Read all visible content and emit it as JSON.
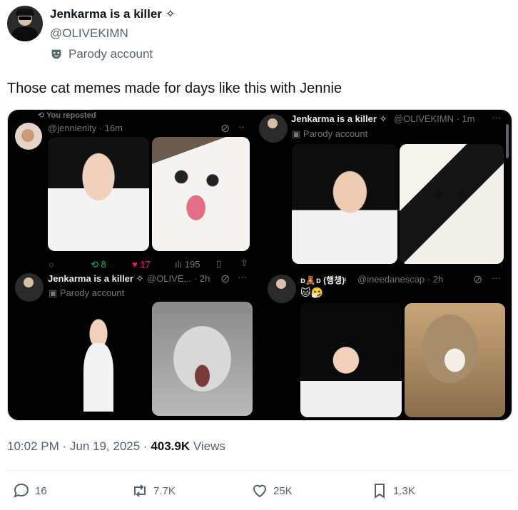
{
  "author": {
    "name": "Jenkarma is a killer ✧",
    "handle": "@OLIVEKIMN",
    "label": "Parody account"
  },
  "tweet": {
    "text": "Those cat memes made for days like this with Jennie",
    "timestamp": "10:02 PM · Jun 19, 2025",
    "views_count": "403.9K",
    "views_label": "Views"
  },
  "media": {
    "q1": {
      "repost_label": "You reposted",
      "handle_time": "@jennienity · 16m",
      "stats": {
        "replies": "",
        "reposts": "8",
        "likes": "17",
        "views": "195"
      }
    },
    "q2": {
      "name": "Jenkarma is a killer ✧",
      "handle_time": "@OLIVEKIMN · 1m",
      "label": "Parody account",
      "more": "···"
    },
    "q3": {
      "name": "Jenkarma is a killer ✧",
      "handle_time": "@OLIVE... · 2h",
      "label": "Parody account",
      "more": "···"
    },
    "q4": {
      "name": "ᴅ🧸ᴅ (행챙)ᵎ",
      "handle_time": "@ineedanescap · 2h",
      "emojis": "🐱🤧",
      "more": "···"
    },
    "q1_more": "··"
  },
  "actions": {
    "replies": "16",
    "reposts": "7.7K",
    "likes": "25K",
    "bookmarks": "1.3K"
  },
  "colors": {
    "text": "#0f1419",
    "secondary": "#536471",
    "like_pink": "#f91880",
    "repost_green": "#00ba7c"
  }
}
